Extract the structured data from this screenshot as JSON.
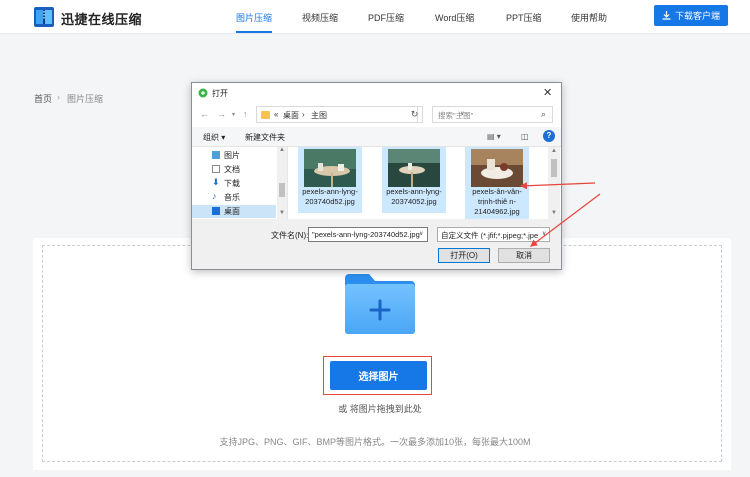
{
  "header": {
    "brand": "迅捷在线压缩",
    "nav": [
      "图片压缩",
      "视频压缩",
      "PDF压缩",
      "Word压缩",
      "PPT压缩",
      "使用帮助"
    ],
    "download_label": "下载客户端",
    "colors": {
      "accent": "#1677e6",
      "highlight": "#e8453c"
    }
  },
  "breadcrumb": {
    "home": "首页",
    "current": "图片压缩"
  },
  "upload": {
    "choose_label": "选择图片",
    "drag_hint": "或 将图片拖拽到此处",
    "support_text": "支持JPG、PNG、GIF、BMP等图片格式。一次最多添加10张，每张最大100M"
  },
  "dialog": {
    "title": "打开",
    "address": {
      "prefix": "«",
      "path1": "桌面",
      "sep": "›",
      "path2": "主图"
    },
    "search_placeholder": "搜索\"主图\"",
    "toolbar": {
      "organize": "组织 ▾",
      "new_folder": "新建文件夹"
    },
    "sidebar": [
      {
        "label": "图片",
        "icon": "pictures-icon"
      },
      {
        "label": "文档",
        "icon": "documents-icon"
      },
      {
        "label": "下载",
        "icon": "download-icon"
      },
      {
        "label": "音乐",
        "icon": "music-icon"
      },
      {
        "label": "桌面",
        "icon": "desktop-icon",
        "selected": true
      }
    ],
    "files": [
      {
        "name": "pexels-ann-lyng-203740d52.jpg"
      },
      {
        "name": "pexels-ann-lyng-20374052.jpg"
      },
      {
        "name": "pexels-ân-vân-trịnh-thiê n-21404962.jpg"
      }
    ],
    "filename_label": "文件名(N):",
    "filename_value": "\"pexels-ann-lyng-203740d52.jpg\" \"pexels-ann-lyng-20374052.jpg\"",
    "filetype_value": "自定义文件 (*.jfif;*.pjpeg;*.jpe",
    "open_label": "打开(O)",
    "cancel_label": "取消"
  }
}
